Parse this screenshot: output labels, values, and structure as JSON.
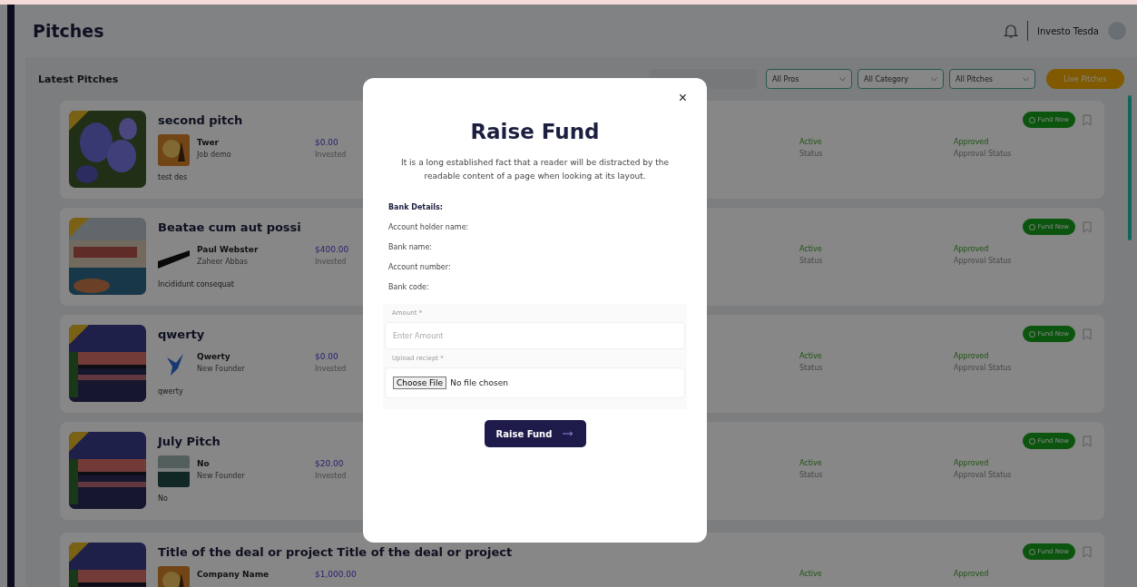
{
  "header": {
    "title": "Pitches",
    "user": "Investo Tesda"
  },
  "toolbar": {
    "title": "Latest Pitches",
    "filters": [
      "All Pros",
      "All Category",
      "All Pitches"
    ],
    "live_button": "Live Pitches"
  },
  "pitches": [
    {
      "title": "second pitch",
      "author": "Twer",
      "author_role": "Job demo",
      "amount": "$0.00",
      "amount_label": "Invested",
      "description": "test des",
      "status": "Active",
      "status_label": "Status",
      "approval": "Approved",
      "approval_label": "Approval Status",
      "action": "Fund Now"
    },
    {
      "title": "Beatae cum aut possi",
      "author": "Paul Webster",
      "author_role": "Zaheer Abbas",
      "amount": "$400.00",
      "amount_label": "Invested",
      "description": "Incididunt consequat",
      "status": "Active",
      "status_label": "Status",
      "approval": "Approved",
      "approval_label": "Approval Status",
      "action": "Fund Now"
    },
    {
      "title": "qwerty",
      "author": "Qwerty",
      "author_role": "New Founder",
      "amount": "$0.00",
      "amount_label": "Invested",
      "description": "qwerty",
      "status": "Active",
      "status_label": "Status",
      "approval": "Approved",
      "approval_label": "Approval Status",
      "action": "Fund Now"
    },
    {
      "title": "July Pitch",
      "author": "No",
      "author_role": "New Founder",
      "amount": "$20.00",
      "amount_label": "Invested",
      "description": "No",
      "status": "Active",
      "status_label": "Status",
      "approval": "Approved",
      "approval_label": "Approval Status",
      "action": "Fund Now"
    },
    {
      "title": "Title of the deal or project Title of the deal or project",
      "author": "Company Name",
      "amount": "$1,000.00",
      "status": "Active",
      "approval": "Approved",
      "action": "Fund Now"
    }
  ],
  "modal": {
    "close": "×",
    "title": "Raise Fund",
    "text": "It is a long established fact that a reader will be distracted by the readable content of a page when looking at its layout.",
    "bank_heading": "Bank Details:",
    "bank_fields": [
      "Account holder name:",
      "Bank name:",
      "Account number:",
      "Bank code:"
    ],
    "amount_label": "Amount *",
    "amount_placeholder": "Enter Amount",
    "upload_label": "Upload reciept *",
    "file_button": "Choose File",
    "file_status": "No file chosen",
    "submit": "Raise Fund"
  }
}
